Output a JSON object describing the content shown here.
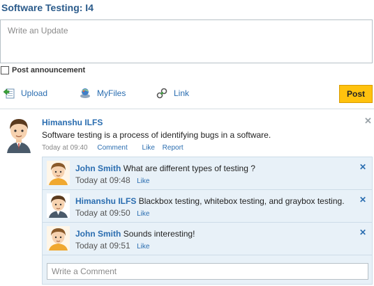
{
  "header": {
    "title": "Software Testing: I4"
  },
  "composer": {
    "placeholder": "Write an Update",
    "announcement_label": "Post announcement",
    "actions": {
      "upload": "Upload",
      "myfiles": "MyFiles",
      "link": "Link"
    },
    "post_label": "Post"
  },
  "post": {
    "author": "Himanshu ILFS",
    "text": "Software testing is a process of identifying bugs in a software.",
    "time": "Today at 09:40",
    "comment_label": "Comment",
    "like_label": "Like",
    "report_label": "Report",
    "close_glyph": "✕"
  },
  "comments": [
    {
      "author": "John Smith",
      "text": "What are different types of testing ?",
      "time": "Today at 09:48",
      "like_label": "Like",
      "close_glyph": "✕"
    },
    {
      "author": "Himanshu ILFS",
      "text": "Blackbox testing, whitebox testing, and graybox testing.",
      "time": "Today at 09:50",
      "like_label": "Like",
      "close_glyph": "✕"
    },
    {
      "author": "John Smith",
      "text": "Sounds interesting!",
      "time": "Today at 09:51",
      "like_label": "Like",
      "close_glyph": "✕"
    }
  ],
  "comment_input": {
    "placeholder": "Write a Comment"
  },
  "colors": {
    "link": "#2a6db0",
    "title": "#2a5a8a",
    "post_button": "#ffc20e",
    "comment_bg": "#e8f1f8"
  },
  "icons": {
    "upload": "upload-icon",
    "myfiles": "myfiles-icon",
    "link": "link-icon"
  }
}
